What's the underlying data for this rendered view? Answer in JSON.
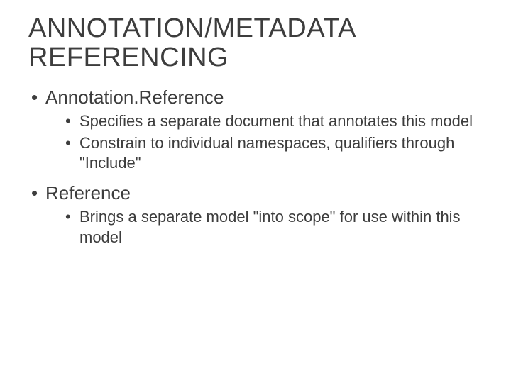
{
  "slide": {
    "title": "ANNOTATION/METADATA REFERENCING",
    "items": [
      {
        "label": "Annotation.Reference",
        "subitems": [
          "Specifies a separate document that annotates this model",
          "Constrain to individual namespaces, qualifiers through \"Include\""
        ]
      },
      {
        "label": "Reference",
        "subitems": [
          "Brings a separate model \"into scope\" for use within this model"
        ]
      }
    ]
  }
}
